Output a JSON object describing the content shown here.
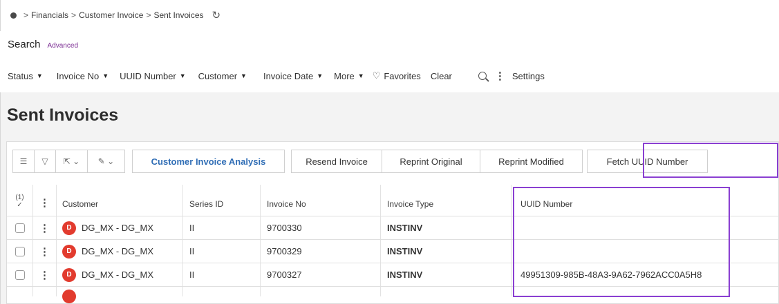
{
  "breadcrumb": {
    "items": [
      "Financials",
      "Customer Invoice",
      "Sent Invoices"
    ],
    "separator": ">"
  },
  "search": {
    "label": "Search",
    "advanced_label": "Advanced"
  },
  "filters": {
    "status": "Status",
    "invoice_no": "Invoice No",
    "uuid_number": "UUID Number",
    "customer": "Customer",
    "invoice_date": "Invoice Date",
    "more": "More",
    "favorites": "Favorites",
    "clear": "Clear",
    "settings": "Settings"
  },
  "page": {
    "title": "Sent Invoices"
  },
  "toolbar": {
    "customer_invoice_analysis": "Customer Invoice Analysis",
    "resend_invoice": "Resend Invoice",
    "reprint_original": "Reprint Original",
    "reprint_modified": "Reprint Modified",
    "fetch_uuid_number": "Fetch UUID Number"
  },
  "table": {
    "selected_count": "(1)",
    "headers": {
      "customer": "Customer",
      "series_id": "Series ID",
      "invoice_no": "Invoice No",
      "invoice_type": "Invoice Type",
      "uuid_number": "UUID Number"
    },
    "rows": [
      {
        "avatar": "D",
        "customer": "DG_MX - DG_MX",
        "series_id": "II",
        "invoice_no": "9700330",
        "invoice_type": "INSTINV",
        "uuid_number": ""
      },
      {
        "avatar": "D",
        "customer": "DG_MX - DG_MX",
        "series_id": "II",
        "invoice_no": "9700329",
        "invoice_type": "INSTINV",
        "uuid_number": ""
      },
      {
        "avatar": "D",
        "customer": "DG_MX - DG_MX",
        "series_id": "II",
        "invoice_no": "9700327",
        "invoice_type": "INSTINV",
        "uuid_number": "49951309-985B-48A3-9A62-7962ACC0A5H8"
      }
    ]
  },
  "colors": {
    "highlight": "#8a3fd1",
    "primary_link": "#2f6db5",
    "avatar": "#e23b2e",
    "advanced_link": "#7a2b92"
  }
}
